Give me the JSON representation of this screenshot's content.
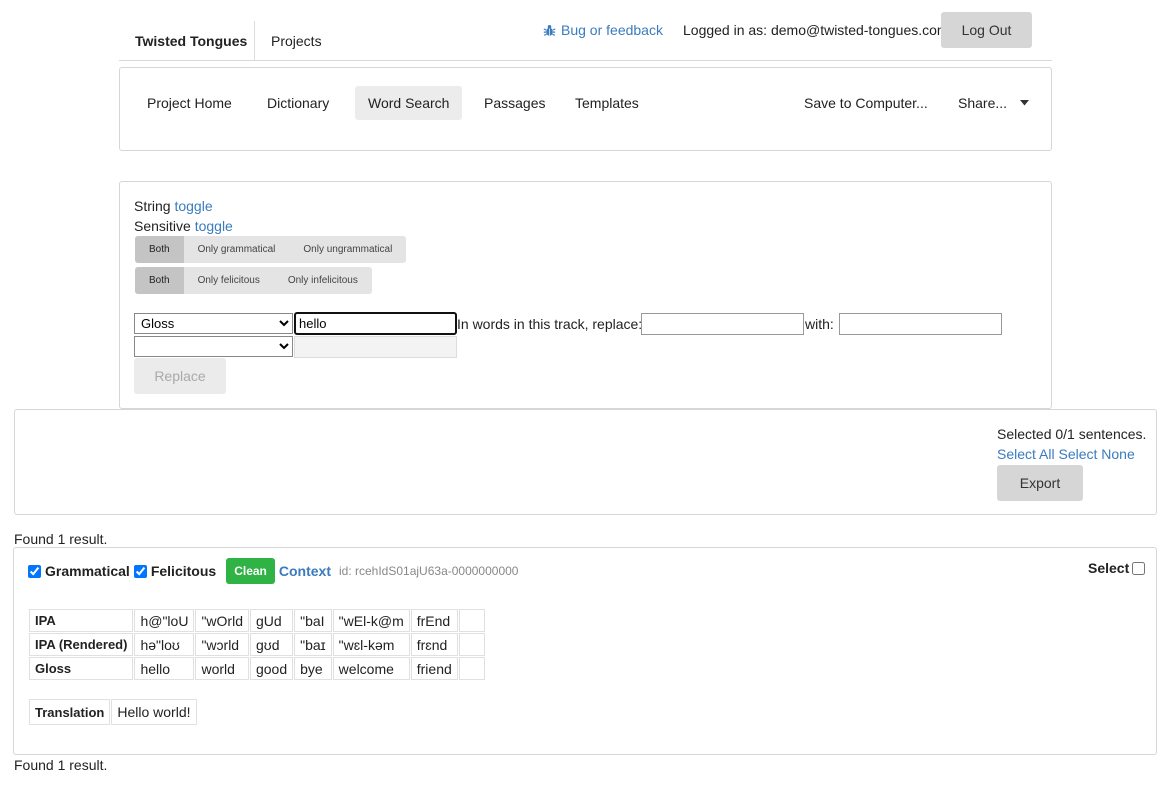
{
  "app": {
    "brand": "Twisted Tongues",
    "projects_link": "Projects",
    "feedback_link": "Bug or feedback",
    "logged_in_text": "Logged in as: demo@twisted-tongues.com",
    "logout_label": "Log Out"
  },
  "project_nav": {
    "items": [
      {
        "label": "Project Home"
      },
      {
        "label": "Dictionary"
      },
      {
        "label": "Word Search"
      },
      {
        "label": "Passages"
      },
      {
        "label": "Templates"
      }
    ],
    "active": "Word Search",
    "save_label": "Save to Computer...",
    "share_label": "Share..."
  },
  "search": {
    "string_label": "String",
    "sensitive_label": "Sensitive",
    "toggle_label": "toggle",
    "grammatical_filter": [
      "Both",
      "Only grammatical",
      "Only ungrammatical"
    ],
    "felicitous_filter": [
      "Both",
      "Only felicitous",
      "Only infelicitous"
    ],
    "field1_selected": "Gloss",
    "field1_value": "hello",
    "field2_selected": "",
    "field2_value": "",
    "replace_prompt": "In words in this track, replace:",
    "replace_from": "",
    "with_label": "with:",
    "replace_to": "",
    "replace_button": "Replace"
  },
  "selection": {
    "status": "Selected 0/1 sentences.",
    "select_all": "Select All",
    "select_none": "Select None",
    "export_label": "Export"
  },
  "results": {
    "found_text": "Found 1 result.",
    "items": [
      {
        "grammatical_label": "Grammatical",
        "grammatical_checked": true,
        "felicitous_label": "Felicitous",
        "felicitous_checked": true,
        "clean_label": "Clean",
        "context_label": "Context",
        "id_text": "id: rcehIdS01ajU63a-0000000000",
        "select_label": "Select",
        "rows": [
          {
            "label": "IPA",
            "words": [
              "h@\"loU",
              "\"wOrld",
              "gUd",
              "\"baI",
              "\"wEl-k@m",
              "frEnd",
              ""
            ]
          },
          {
            "label": "IPA (Rendered)",
            "words": [
              "hə\"loʊ",
              "\"wɔrld",
              "gʊd",
              "\"baɪ",
              "\"wɛl-kəm",
              "frɛnd",
              ""
            ]
          },
          {
            "label": "Gloss",
            "words": [
              "hello",
              "world",
              "good",
              "bye",
              "welcome",
              "friend",
              ""
            ]
          }
        ],
        "translation_label": "Translation",
        "translation": "Hello world!"
      }
    ]
  },
  "colors": {
    "link": "#3a7bbf",
    "clean_badge": "#2fb344",
    "button_gray": "#d6d6d6"
  }
}
